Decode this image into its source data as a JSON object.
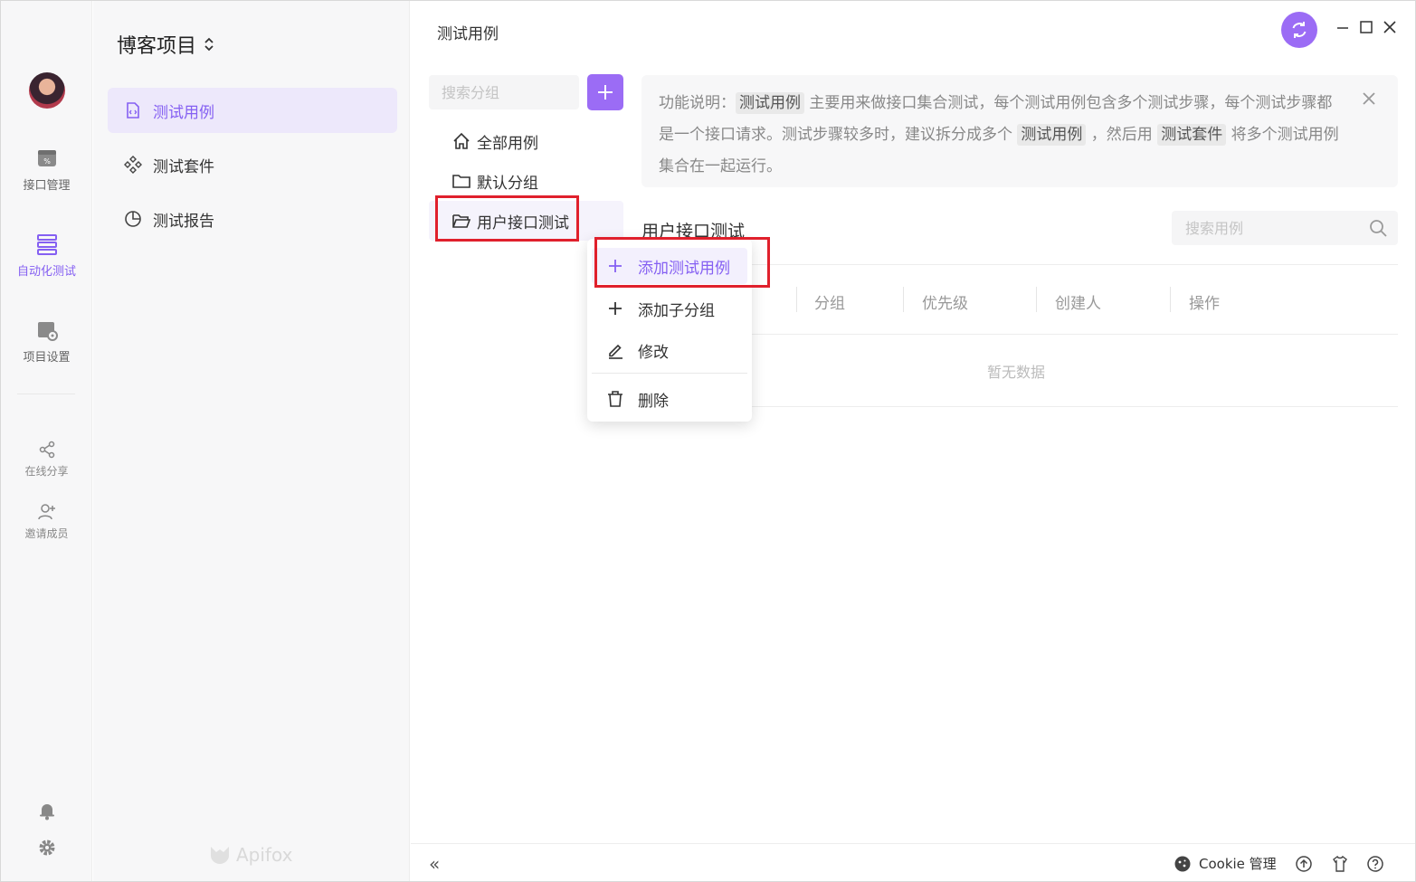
{
  "rail": {
    "items": [
      {
        "label": "接口管理",
        "icon": "api-icon"
      },
      {
        "label": "自动化测试",
        "icon": "automation-icon",
        "active": true
      },
      {
        "label": "项目设置",
        "icon": "settings-folder-icon"
      }
    ],
    "extras": [
      {
        "label": "在线分享",
        "icon": "share-icon"
      },
      {
        "label": "邀请成员",
        "icon": "invite-user-icon"
      }
    ]
  },
  "sidebar": {
    "project_title": "博客项目",
    "items": [
      {
        "label": "测试用例",
        "active": true
      },
      {
        "label": "测试套件"
      },
      {
        "label": "测试报告"
      }
    ],
    "brand": "Apifox"
  },
  "main": {
    "title": "测试用例",
    "group_search_placeholder": "搜索分组",
    "tree": [
      {
        "label": "全部用例",
        "icon": "home-icon"
      },
      {
        "label": "默认分组",
        "icon": "folder-icon"
      },
      {
        "label": "用户接口测试",
        "icon": "folder-open-icon",
        "selected": true
      }
    ],
    "notice": {
      "prefix": "功能说明：",
      "tag1": "测试用例",
      "text1": " 主要用来做接口集合测试，每个测试用例包含多个测试步骤，每个测试步骤都是一个接口请求。测试步骤较多时，建议拆分成多个 ",
      "tag2": "测试用例",
      "text2": " ，然后用 ",
      "tag3": "测试套件",
      "text3": " 将多个测试用例集合在一起运行。"
    },
    "folder_title": "用户接口测试",
    "case_search_placeholder": "搜索用例",
    "columns": [
      "分组",
      "优先级",
      "创建人",
      "操作"
    ],
    "empty_text": "暂无数据"
  },
  "context_menu": {
    "items": [
      {
        "label": "添加测试用例",
        "icon": "plus-icon",
        "active": true
      },
      {
        "label": "添加子分组",
        "icon": "plus-icon"
      },
      {
        "label": "修改",
        "icon": "edit-icon"
      },
      {
        "label": "删除",
        "icon": "trash-icon"
      }
    ]
  },
  "footer": {
    "collapse": "«",
    "cookie_label": "Cookie 管理"
  },
  "colors": {
    "accent": "#9b6cf5",
    "accent_text": "#8560f2",
    "highlight_box": "#e0202c"
  }
}
